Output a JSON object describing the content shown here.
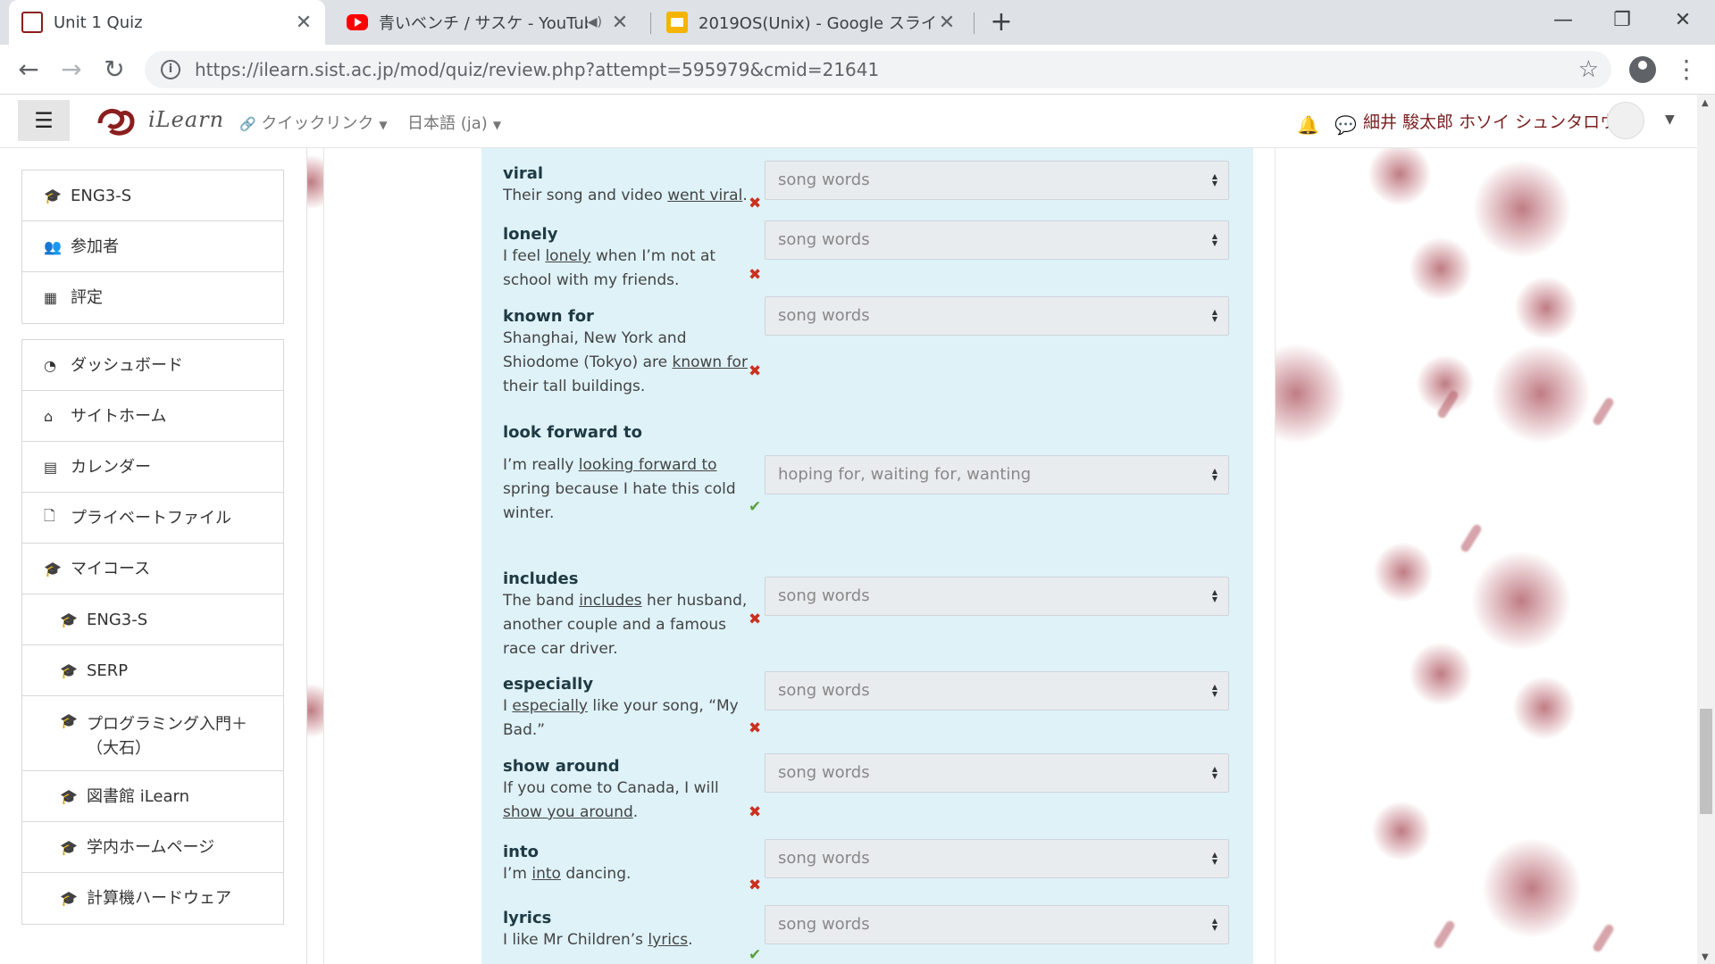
{
  "browser": {
    "tabs": [
      {
        "title": "Unit 1 Quiz",
        "favicon": "moodle-icon",
        "active": true
      },
      {
        "title": "青いベンチ / サスケ - YouTube",
        "favicon": "youtube-icon",
        "active": false
      },
      {
        "title": "2019OS(Unix) - Google スライド",
        "favicon": "slides-icon",
        "active": false
      }
    ],
    "new_tab": "+",
    "window": {
      "minimize": "—",
      "restore": "❐",
      "close": "✕"
    },
    "url_host": "https://ilearn.sist.ac.jp",
    "url_path": "/mod/quiz/review.php?attempt=595979&cmid=21641"
  },
  "header": {
    "site_name": "iLearn",
    "quick_links": "クイックリンク",
    "language": "日本語 (ja)",
    "user_name": "細井 駿太郎 ホソイ シュンタロウ"
  },
  "nav": {
    "course_block": [
      {
        "label": "ENG3-S",
        "icon": "graduation-cap-icon"
      },
      {
        "label": "参加者",
        "icon": "users-icon"
      },
      {
        "label": "評定",
        "icon": "table-icon"
      }
    ],
    "main_block": [
      {
        "label": "ダッシュボード",
        "icon": "dashboard-icon"
      },
      {
        "label": "サイトホーム",
        "icon": "home-icon"
      },
      {
        "label": "カレンダー",
        "icon": "calendar-icon"
      },
      {
        "label": "プライベートファイル",
        "icon": "file-icon"
      },
      {
        "label": "マイコース",
        "icon": "graduation-cap-icon"
      },
      {
        "label": "ENG3-S",
        "icon": "graduation-cap-icon"
      },
      {
        "label": "SERP",
        "icon": "graduation-cap-icon"
      },
      {
        "label": "プログラミング入門＋（大石）",
        "icon": "graduation-cap-icon"
      },
      {
        "label": "図書館 iLearn",
        "icon": "graduation-cap-icon"
      },
      {
        "label": "学内ホームページ",
        "icon": "graduation-cap-icon"
      },
      {
        "label": "計算機ハードウェア",
        "icon": "graduation-cap-icon"
      }
    ]
  },
  "questions": [
    {
      "word": "viral",
      "pre": "Their song and video ",
      "u": "went viral",
      "post": ".",
      "answer": "song words",
      "correct": false
    },
    {
      "word": "lonely",
      "pre": "I feel ",
      "u": "lonely",
      "post": " when I’m not at school with my friends.",
      "answer": "song words",
      "correct": false
    },
    {
      "word": "known for",
      "pre": "Shanghai, New York and Shiodome (Tokyo) are ",
      "u": "known for",
      "post": " their tall buildings.",
      "answer": "song words",
      "correct": false
    },
    {
      "word": "look forward to",
      "pre": "I’m really ",
      "u": "looking forward to",
      "post": " spring because I hate this cold winter.",
      "answer": "hoping for, waiting for, wanting",
      "correct": true
    },
    {
      "word": "includes",
      "pre": "The band ",
      "u": "includes",
      "post": " her husband, another couple and a famous race car driver.",
      "answer": "song words",
      "correct": false
    },
    {
      "word": "especially",
      "pre": "I ",
      "u": "especially",
      "post": " like your song, “My Bad.”",
      "answer": "song words",
      "correct": false
    },
    {
      "word": "show around",
      "pre": "If you come to Canada, I will ",
      "u": "show you around",
      "post": ".",
      "answer": "song words",
      "correct": false
    },
    {
      "word": "into",
      "pre": "I’m ",
      "u": "into",
      "post": " dancing.",
      "answer": "song words",
      "correct": false
    },
    {
      "word": "lyrics",
      "pre": "I like Mr Children’s ",
      "u": "lyrics",
      "post": ".",
      "answer": "song words",
      "correct": true
    }
  ],
  "marks": {
    "wrong": "✖",
    "right": "✔"
  },
  "colors": {
    "panel": "#def2f8",
    "wrong": "#ca3120",
    "right": "#5aa13e",
    "brand": "#7a1f1f"
  }
}
